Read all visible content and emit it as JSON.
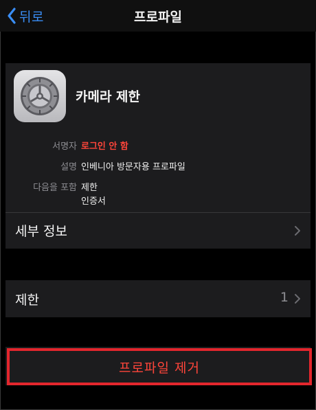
{
  "nav": {
    "back_label": "뒤로",
    "title": "프로파일"
  },
  "profile": {
    "name": "카메라 제한",
    "icon": "settings-gear-icon",
    "signer_label": "서명자",
    "signer_value": "로그인 안 함",
    "description_label": "설명",
    "description_value": "인베니아 방문자용 프로파일",
    "contains_label": "다음을 포함",
    "contains_values": [
      "제한",
      "인증서"
    ],
    "details_label": "세부 정보"
  },
  "restrictions": {
    "label": "제한",
    "count": "1"
  },
  "actions": {
    "remove_label": "프로파일 제거"
  },
  "colors": {
    "accent_blue": "#3a8ef6",
    "destructive_red": "#ff453a",
    "highlight_border": "#e3262d",
    "background": "#000000",
    "cell_background": "#1c1c1e"
  }
}
